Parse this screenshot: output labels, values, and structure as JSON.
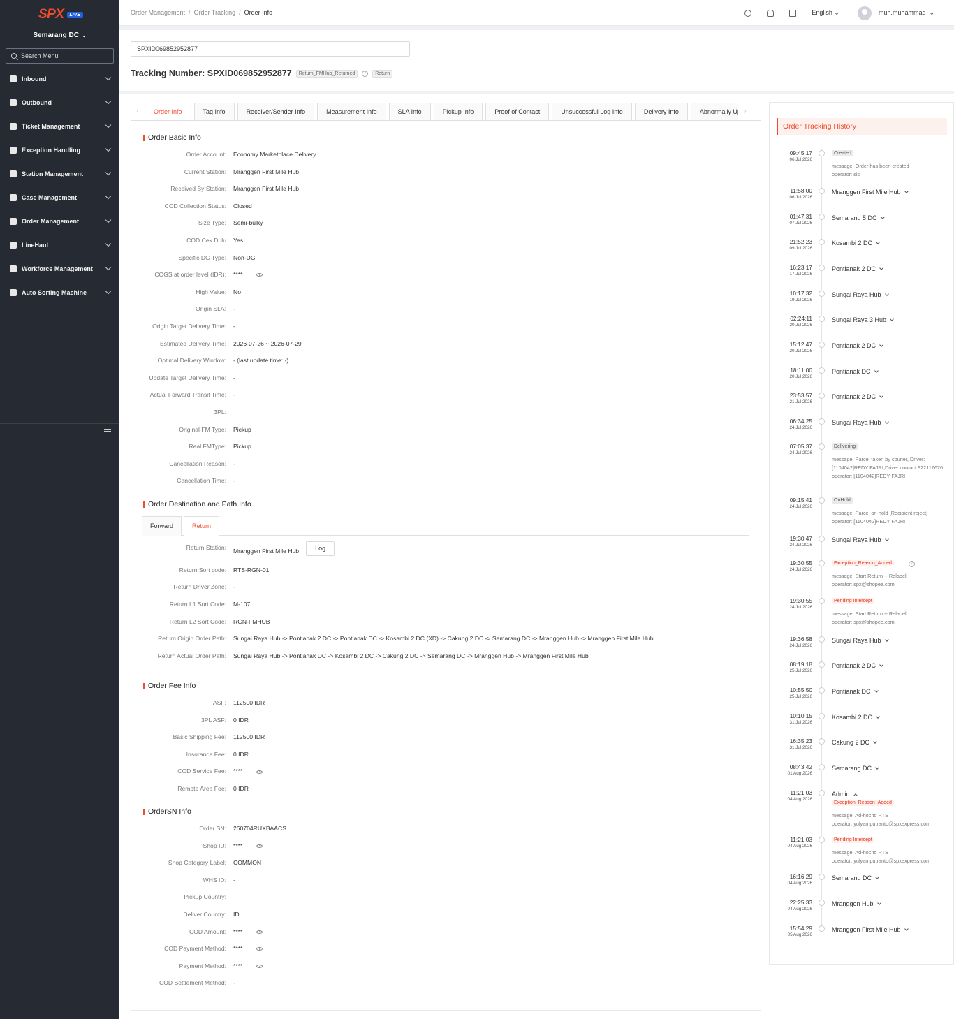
{
  "brand": {
    "logo_text": "SPX",
    "live_badge": "LIVE",
    "accent": "#ee4d2d"
  },
  "sidebar": {
    "station": "Semarang DC",
    "search_placeholder": "Search Menu",
    "items": [
      {
        "label": "Inbound",
        "icon": "inbound-icon"
      },
      {
        "label": "Outbound",
        "icon": "outbound-icon"
      },
      {
        "label": "Ticket Management",
        "icon": "ticket-icon"
      },
      {
        "label": "Exception Handling",
        "icon": "exception-icon"
      },
      {
        "label": "Station Management",
        "icon": "home-icon"
      },
      {
        "label": "Case Management",
        "icon": "case-icon"
      },
      {
        "label": "Order Management",
        "icon": "order-icon"
      },
      {
        "label": "LineHaul",
        "icon": "truck-icon"
      },
      {
        "label": "Workforce Management",
        "icon": "user-icon"
      },
      {
        "label": "Auto Sorting Machine",
        "icon": "gear-icon"
      }
    ]
  },
  "header": {
    "breadcrumb": [
      "Order Management",
      "Order Tracking",
      "Order Info"
    ],
    "language": "English",
    "username": "muh.muhammad"
  },
  "search": {
    "value": "SPXID069852952877"
  },
  "tracking": {
    "label": "Tracking Number: SPXID069852952877",
    "status_tag": "Return_FMHub_Returned",
    "type_tag": "Return"
  },
  "tabs": [
    "Order Info",
    "Tag Info",
    "Receiver/Sender Info",
    "Measurement Info",
    "SLA Info",
    "Pickup Info",
    "Proof of Contact",
    "Unsuccessful Log Info",
    "Delivery Info",
    "Abnormally Upda"
  ],
  "basic_info": {
    "title": "Order Basic Info",
    "rows": [
      {
        "label": "Order Account:",
        "value": "Economy Marketplace Delivery"
      },
      {
        "label": "Current Station:",
        "value": "Mranggen First Mile Hub"
      },
      {
        "label": "Received By Station:",
        "value": "Mranggen First Mile Hub"
      },
      {
        "label": "COD Collection Status:",
        "value": "Closed"
      },
      {
        "label": "Size Type:",
        "value": "Semi-bulky"
      },
      {
        "label": "COD Cek Dulu",
        "value": "Yes"
      },
      {
        "label": "Specific DG Type:",
        "value": "Non-DG"
      },
      {
        "label": "COGS at order level (IDR):",
        "value": "****",
        "eye": true
      },
      {
        "label": "High Value:",
        "value": "No"
      },
      {
        "label": "Origin SLA:",
        "value": "-"
      },
      {
        "label": "Origin Target Delivery Time:",
        "value": "-"
      },
      {
        "label": "Estimated Delivery Time:",
        "value": "2026-07-26 ~ 2026-07-29"
      },
      {
        "label": "Optimal Delivery Window:",
        "value": "- (last update time: -)"
      },
      {
        "label": "Update Target Delivery Time:",
        "value": "-"
      },
      {
        "label": "Actual Forward Transit Time:",
        "value": "-"
      },
      {
        "label": "3PL:",
        "value": ""
      },
      {
        "label": "Original FM Type:",
        "value": "Pickup"
      },
      {
        "label": "Real FMType:",
        "value": "Pickup"
      },
      {
        "label": "Cancellation Reason:",
        "value": "-"
      },
      {
        "label": "Cancellation Time:",
        "value": "-"
      }
    ]
  },
  "path_info": {
    "title": "Order Destination and Path Info",
    "subtabs": [
      "Forward",
      "Return"
    ],
    "log_label": "Log",
    "rows": [
      {
        "label": "Return Station:",
        "value": "Mranggen First Mile Hub"
      },
      {
        "label": "Return Sort code:",
        "value": "RTS-RGN-01"
      },
      {
        "label": "Return Driver Zone:",
        "value": "-"
      },
      {
        "label": "Return L1 Sort Code:",
        "value": "M-107"
      },
      {
        "label": "Return L2 Sort Code:",
        "value": "RGN-FMHUB"
      },
      {
        "label": "Return Origin Order Path:",
        "value": "Sungai Raya Hub  -> Pontianak 2 DC  -> Pontianak DC  -> Kosambi 2 DC (XD)  -> Cakung 2 DC  -> Semarang DC  -> Mranggen Hub  -> Mranggen First Mile Hub"
      },
      {
        "label": "Return Actual Order Path:",
        "value": "Sungai Raya Hub  -> Pontianak DC  -> Kosambi 2 DC  -> Cakung 2 DC  -> Semarang DC  -> Mranggen Hub  -> Mranggen First Mile Hub"
      }
    ]
  },
  "fee_info": {
    "title": "Order Fee Info",
    "rows": [
      {
        "label": "ASF:",
        "value": "112500 IDR"
      },
      {
        "label": "3PL ASF:",
        "value": "0 IDR"
      },
      {
        "label": "Basic Shipping Fee:",
        "value": "112500 IDR"
      },
      {
        "label": "Insurance Fee:",
        "value": "0 IDR"
      },
      {
        "label": "COD Service Fee:",
        "value": "****",
        "eye": true
      },
      {
        "label": "Remote Area Fee:",
        "value": "0 IDR"
      }
    ]
  },
  "sn_info": {
    "title": "OrderSN Info",
    "rows": [
      {
        "label": "Order SN:",
        "value": "260704RUXBAACS"
      },
      {
        "label": "Shop ID:",
        "value": "****",
        "eye": true
      },
      {
        "label": "Shop Category Label:",
        "value": "COMMON"
      },
      {
        "label": "WHS ID:",
        "value": "-"
      },
      {
        "label": "Pickup Country:",
        "value": ""
      },
      {
        "label": "Deliver Country:",
        "value": "ID"
      },
      {
        "label": "COD Amount:",
        "value": "****",
        "eye": true
      },
      {
        "label": "COD Payment Method:",
        "value": "****",
        "eye": true
      },
      {
        "label": "Payment Method:",
        "value": "****",
        "eye": true
      },
      {
        "label": "COD Settlement Method:",
        "value": "-"
      }
    ]
  },
  "history": {
    "title": "Order Tracking History",
    "events": [
      {
        "time": "09:45:17",
        "date": "06 Jul 2026",
        "badge": "Created",
        "badge_style": "grey",
        "messages": [
          "message: Order has been created",
          "operator: sls"
        ]
      },
      {
        "time": "11:58:00",
        "date": "06 Jul 2026",
        "location": "Mranggen First Mile Hub"
      },
      {
        "time": "01:47:31",
        "date": "07 Jul 2026",
        "location": "Semarang 5 DC"
      },
      {
        "time": "21:52:23",
        "date": "09 Jul 2026",
        "location": "Kosambi 2 DC"
      },
      {
        "time": "16:23:17",
        "date": "17 Jul 2026",
        "location": "Pontianak 2 DC"
      },
      {
        "time": "10:17:32",
        "date": "19 Jul 2026",
        "location": "Sungai Raya Hub"
      },
      {
        "time": "02:24:11",
        "date": "20 Jul 2026",
        "location": "Sungai Raya 3 Hub"
      },
      {
        "time": "15:12:47",
        "date": "20 Jul 2026",
        "location": "Pontianak 2 DC"
      },
      {
        "time": "18:11:00",
        "date": "20 Jul 2026",
        "location": "Pontianak DC"
      },
      {
        "time": "23:53:57",
        "date": "21 Jul 2026",
        "location": "Pontianak 2 DC"
      },
      {
        "time": "06:34:25",
        "date": "24 Jul 2026",
        "location": "Sungai Raya Hub"
      },
      {
        "time": "07:05:37",
        "date": "24 Jul 2026",
        "badge": "Delivering",
        "badge_style": "grey",
        "messages": [
          "message: Parcel taken by courier, Driver: [1104042]REDY FAJRI,Driver contact:922117676",
          "operator: [1104042]REDY FAJRI"
        ]
      },
      {
        "time": "09:15:41",
        "date": "24 Jul 2026",
        "badge": "OnHold",
        "badge_style": "grey",
        "messages": [
          "message: Parcel on-hold [Recipient reject]",
          "operator: [1104042]REDY FAJRI"
        ]
      },
      {
        "time": "19:30:47",
        "date": "24 Jul 2026",
        "location": "Sungai Raya Hub"
      },
      {
        "time": "19:30:55",
        "date": "24 Jul 2026",
        "badge": "Exception_Reason_Added",
        "badge_style": "red",
        "messages": [
          "message: Start Return -- Relabel",
          "operator: spx@shopee.com"
        ]
      },
      {
        "time": "19:30:55",
        "date": "24 Jul 2026",
        "badge": "Pending Intercept",
        "badge_style": "red",
        "messages": [
          "message: Start Return -- Relabel",
          "operator: spx@shopee.com"
        ]
      },
      {
        "time": "19:36:58",
        "date": "24 Jul 2026",
        "location": "Sungai Raya Hub"
      },
      {
        "time": "08:19:18",
        "date": "25 Jul 2026",
        "location": "Pontianak 2 DC"
      },
      {
        "time": "10:55:50",
        "date": "25 Jul 2026",
        "location": "Pontianak DC"
      },
      {
        "time": "10:10:15",
        "date": "31 Jul 2026",
        "location": "Kosambi 2 DC"
      },
      {
        "time": "16:35:23",
        "date": "31 Jul 2026",
        "location": "Cakung 2 DC"
      },
      {
        "time": "08:43:42",
        "date": "01 Aug 2026",
        "location": "Semarang DC"
      },
      {
        "time": "11:21:03",
        "date": "04 Aug 2026",
        "location": "Admin",
        "expanded": true,
        "badge": "Exception_Reason_Added",
        "badge_style": "red",
        "messages": [
          "message: Ad-hoc to RTS",
          "operator: yulyan.putranto@spxexpress.com"
        ]
      },
      {
        "time": "11:21:03",
        "date": "04 Aug 2026",
        "badge": "Pending Intercept",
        "badge_style": "red",
        "messages": [
          "message: Ad-hoc to RTS",
          "operator: yulyan.putranto@spxexpress.com"
        ]
      },
      {
        "time": "16:16:29",
        "date": "04 Aug 2026",
        "location": "Semarang DC"
      },
      {
        "time": "22:25:33",
        "date": "04 Aug 2026",
        "location": "Mranggen Hub"
      },
      {
        "time": "15:54:29",
        "date": "05 Aug 2026",
        "location": "Mranggen First Mile Hub"
      }
    ]
  }
}
